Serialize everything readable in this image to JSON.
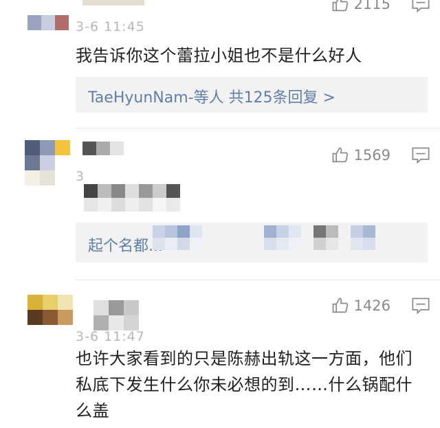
{
  "comments": [
    {
      "time": "3-6 11:45",
      "likes": "2115",
      "text": "我告诉你这个蕾拉小姐也不是什么好人",
      "reply_link": "TaeHyunNam-等人  共125条回复 >"
    },
    {
      "time": "3",
      "likes": "1569",
      "reply_link": "起个名都..."
    },
    {
      "time": "3-6 11:47",
      "likes": "1426",
      "text": "也许大家看到的只是陈赫出轨这一方面，他们私底下发生什么你未必想的到……什么锅配什么盖"
    }
  ],
  "icons": {
    "like": "thumbs-up-icon",
    "reply": "comment-bubble-icon"
  },
  "colors": {
    "link": "#5f7fa8",
    "muted": "#8a8a8a",
    "box": "#f2f2f2"
  }
}
